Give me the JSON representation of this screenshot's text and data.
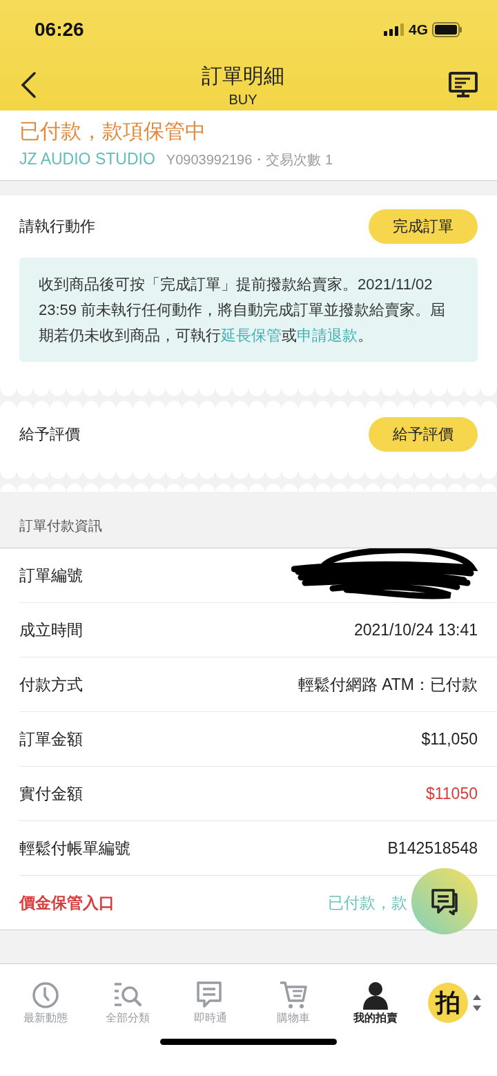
{
  "status_bar": {
    "time": "06:26",
    "network": "4G"
  },
  "header": {
    "title": "訂單明細",
    "subtitle": "BUY"
  },
  "order_status": {
    "text": "已付款，款項保管中",
    "seller": "JZ AUDIO STUDIO",
    "seller_meta": "Y0903992196・交易次數 1"
  },
  "action_card": {
    "label": "請執行動作",
    "button": "完成訂單",
    "notice": [
      {
        "kind": "text",
        "text": "收到商品後可按「完成訂單」提前撥款給賣家。2021/11/02 23:59 前未執行任何動作，將自動完成訂單並撥款給賣家。屆期若仍未收到商品，可執行"
      },
      {
        "kind": "link",
        "text": "延長保管"
      },
      {
        "kind": "text",
        "text": "或"
      },
      {
        "kind": "link",
        "text": "申請退款"
      },
      {
        "kind": "text",
        "text": "。"
      }
    ]
  },
  "rating": {
    "label": "給予評價",
    "button": "給予評價"
  },
  "payment_info": {
    "heading": "訂單付款資訊",
    "rows": [
      {
        "kind": "redacted",
        "label": "訂單編號"
      },
      {
        "kind": "normal",
        "label": "成立時間",
        "value": "2021/10/24 13:41"
      },
      {
        "kind": "normal",
        "label": "付款方式",
        "value": "輕鬆付網路 ATM：已付款"
      },
      {
        "kind": "normal",
        "label": "訂單金額",
        "value": "$11,050"
      },
      {
        "kind": "amount",
        "label": "實付金額",
        "value": "$11050"
      },
      {
        "kind": "normal",
        "label": "輕鬆付帳單編號",
        "value": "B142518548"
      },
      {
        "kind": "escrow",
        "label": "價金保管入口",
        "value": "已付款，款"
      }
    ]
  },
  "bottom_nav": {
    "items": [
      {
        "label": "最新動態",
        "selected": false
      },
      {
        "label": "全部分類",
        "selected": false
      },
      {
        "label": "即時通",
        "selected": false
      },
      {
        "label": "購物車",
        "selected": false
      },
      {
        "label": "我的拍賣",
        "selected": true
      }
    ],
    "logo": "拍"
  }
}
